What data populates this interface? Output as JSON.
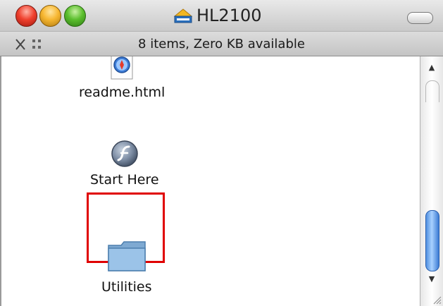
{
  "window": {
    "title": "HL2100",
    "title_icon": "brother-disk-icon",
    "status_text": "8 items, Zero KB available"
  },
  "items": [
    {
      "label": "readme.html",
      "icon": "safari-document-icon"
    },
    {
      "label": "Start Here",
      "icon": "flash-app-icon",
      "selected": true
    },
    {
      "label": "Utilities",
      "icon": "folder-icon"
    }
  ],
  "colors": {
    "selection": "#e00000",
    "scroll_thumb": "#5a9bea",
    "folder": "#8fb9df"
  }
}
